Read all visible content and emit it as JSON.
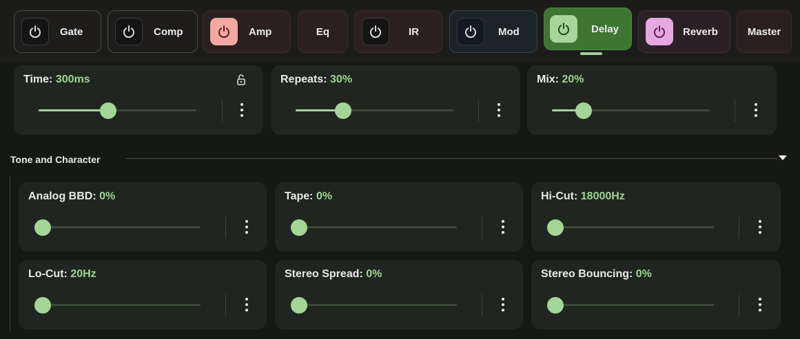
{
  "tabs": [
    {
      "id": "gate",
      "label": "Gate",
      "has_power": true,
      "icon": "power-icon"
    },
    {
      "id": "comp",
      "label": "Comp",
      "has_power": true,
      "icon": "power-icon"
    },
    {
      "id": "amp",
      "label": "Amp",
      "has_power": true,
      "icon": "power-icon",
      "power_color": "#f4a8a2"
    },
    {
      "id": "eq",
      "label": "Eq",
      "has_power": false
    },
    {
      "id": "ir",
      "label": "IR",
      "has_power": true,
      "icon": "power-icon"
    },
    {
      "id": "mod",
      "label": "Mod",
      "has_power": true,
      "icon": "power-icon"
    },
    {
      "id": "delay",
      "label": "Delay",
      "has_power": true,
      "icon": "power-icon",
      "active": true,
      "power_color": "#a8d59a"
    },
    {
      "id": "reverb",
      "label": "Reverb",
      "has_power": true,
      "icon": "power-icon",
      "power_color": "#e7a7e3"
    },
    {
      "id": "master",
      "label": "Master",
      "has_power": false
    }
  ],
  "main_params": [
    {
      "label": "Time: ",
      "value": "300ms",
      "level": 0.44,
      "locked_icon": "lock-open-icon"
    },
    {
      "label": "Repeats: ",
      "value": "30%",
      "level": 0.3
    },
    {
      "label": "Mix: ",
      "value": "20%",
      "level": 0.2
    }
  ],
  "section": {
    "title": "Tone and Character",
    "toggle_icon": "caret-down-icon"
  },
  "tone_params": [
    {
      "label": "Analog BBD: ",
      "value": "0%",
      "level": 0
    },
    {
      "label": "Tape: ",
      "value": "0%",
      "level": 0
    },
    {
      "label": "Hi-Cut: ",
      "value": "18000Hz",
      "level": 0
    },
    {
      "label": "Lo-Cut: ",
      "value": "20Hz",
      "level": 0
    },
    {
      "label": "Stereo Spread: ",
      "value": "0%",
      "level": 0
    },
    {
      "label": "Stereo Bouncing: ",
      "value": "0%",
      "level": 0
    }
  ],
  "colors": {
    "accent": "#a4d596",
    "background": "#161815",
    "card": "#1f2620",
    "delay_tab": "#3e7532"
  }
}
